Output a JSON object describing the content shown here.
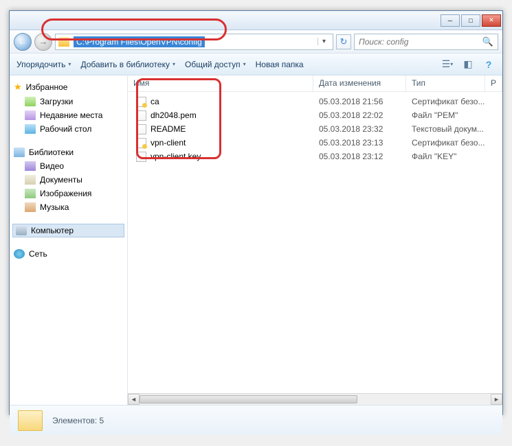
{
  "titlebar": {
    "minimize": "─",
    "maximize": "□",
    "close": "✕"
  },
  "nav": {
    "back": "←",
    "forward": "→",
    "refresh": "↻",
    "dropdown": "▾"
  },
  "address": {
    "path": "C:\\Program Files\\OpenVPN\\config"
  },
  "search": {
    "placeholder": "Поиск: config",
    "icon": "🔍"
  },
  "toolbar": {
    "organize": "Упорядочить",
    "include": "Добавить в библиотеку",
    "share": "Общий доступ",
    "newfolder": "Новая папка",
    "arrow": "▾"
  },
  "sidebar": {
    "fav": "Избранное",
    "items_fav": [
      {
        "label": "Загрузки",
        "cls": "dl"
      },
      {
        "label": "Недавние места",
        "cls": "places"
      },
      {
        "label": "Рабочий стол",
        "cls": "desk"
      }
    ],
    "lib": "Библиотеки",
    "items_lib": [
      {
        "label": "Видео",
        "cls": "vid"
      },
      {
        "label": "Документы",
        "cls": "doc"
      },
      {
        "label": "Изображения",
        "cls": "img"
      },
      {
        "label": "Музыка",
        "cls": "mus"
      }
    ],
    "computer": "Компьютер",
    "network": "Сеть"
  },
  "columns": {
    "name": "Имя",
    "date": "Дата изменения",
    "type": "Тип",
    "r": "Р"
  },
  "files": [
    {
      "name": "ca",
      "date": "05.03.2018 21:56",
      "type": "Сертификат безо...",
      "icn": "cert"
    },
    {
      "name": "dh2048.pem",
      "date": "05.03.2018 22:02",
      "type": "Файл \"PEM\"",
      "icn": "txt"
    },
    {
      "name": "README",
      "date": "05.03.2018 23:32",
      "type": "Текстовый докум...",
      "icn": "txt"
    },
    {
      "name": "vpn-client",
      "date": "05.03.2018 23:13",
      "type": "Сертификат безо...",
      "icn": "cert"
    },
    {
      "name": "vpn-client.key",
      "date": "05.03.2018 23:12",
      "type": "Файл \"KEY\"",
      "icn": "txt"
    }
  ],
  "status": {
    "text": "Элементов: 5"
  },
  "scroll": {
    "left": "◄",
    "right": "►"
  }
}
